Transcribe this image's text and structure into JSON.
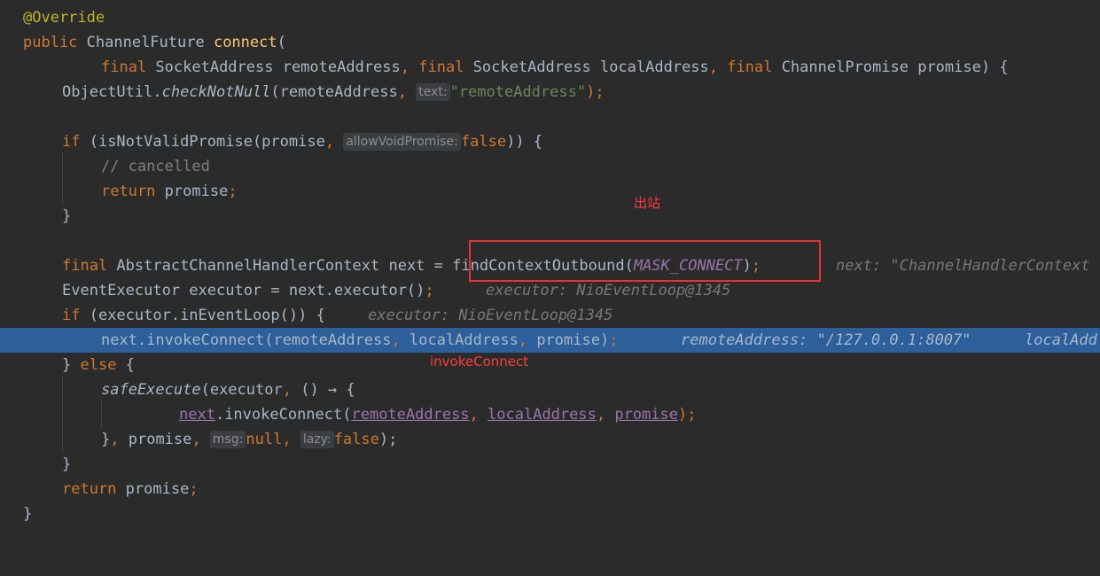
{
  "code": {
    "l1_annotation": "@Override",
    "l2_public": "public ",
    "l2_type": "ChannelFuture ",
    "l2_method": "connect",
    "l2_paren": "(",
    "l3_final1": "final ",
    "l3_param1": "SocketAddress remoteAddress",
    "l3_comma1": ", ",
    "l3_final2": "final ",
    "l3_param2": "SocketAddress localAddress",
    "l3_comma2": ", ",
    "l3_final3": "final ",
    "l3_param3": "ChannelPromise promise) {",
    "l4_obj": "ObjectUtil.",
    "l4_method": "checkNotNull",
    "l4_args": "(remoteAddress",
    "l4_comma": ", ",
    "l4_hint": "text:",
    "l4_str": "\"remoteAddress\"",
    "l4_end": ");",
    "l6_if": "if ",
    "l6_call": "(isNotValidPromise(promise",
    "l6_comma": ", ",
    "l6_hint": "allowVoidPromise:",
    "l6_false": "false",
    "l6_end": ")) {",
    "l7_comment": "// cancelled",
    "l8_return": "return ",
    "l8_promise": "promise",
    "l8_semi": ";",
    "l9_brace": "}",
    "l11_final": "final ",
    "l11_decl": "AbstractChannelHandlerContext next = ",
    "l11_call": "findContextOutbound(",
    "l11_const": "MASK_CONNECT",
    "l11_end": ")",
    "l11_semi": ";",
    "l11_dbg": "next: \"ChannelHandlerContext",
    "l12_code": "EventExecutor executor = next.executor()",
    "l12_semi": ";",
    "l12_dbg": "executor: NioEventLoop@1345",
    "l13_if": "if ",
    "l13_code": "(executor.inEventLoop()) {",
    "l13_dbg": "executor: NioEventLoop@1345",
    "l14_code": "next.invokeConnect(remoteAddress",
    "l14_comma1": ", ",
    "l14_local": "localAddress",
    "l14_comma2": ", ",
    "l14_promise": "promise)",
    "l14_semi": ";",
    "l14_dbg1": "remoteAddress: \"/127.0.0.1:8007\"",
    "l14_dbg2": "localAdd",
    "l15_brace": "} ",
    "l15_else": "else ",
    "l15_open": "{",
    "l16_method": "safeExecute",
    "l16_args": "(executor",
    "l16_comma": ", ",
    "l16_lambda": "() → {",
    "l17_next": "next",
    "l17_call": ".invokeConnect(",
    "l17_remote": "remoteAddress",
    "l17_c1": ", ",
    "l17_local": "localAddress",
    "l17_c2": ", ",
    "l17_promise": "promise",
    "l17_end": ");",
    "l18_brace": "}",
    "l18_c1": ", ",
    "l18_promise": "promise",
    "l18_c2": ", ",
    "l18_hint1": "msg:",
    "l18_null": "null",
    "l18_c3": ", ",
    "l18_hint2": "lazy:",
    "l18_false": "false",
    "l18_end": ");",
    "l19_brace": "}",
    "l20_return": "return ",
    "l20_promise": "promise",
    "l20_semi": ";",
    "l21_brace": "}"
  },
  "annotations": {
    "outbound_note": "出站",
    "invoke_note": "invokeConnect",
    "note_color": "#ff3b3b",
    "box_color": "#e53333"
  },
  "colors": {
    "background": "#2b2b2b",
    "highlight_line": "#2d5f9a",
    "keyword": "#cc7832",
    "method": "#ffc66d",
    "string": "#6a8759",
    "constant": "#9876aa"
  }
}
